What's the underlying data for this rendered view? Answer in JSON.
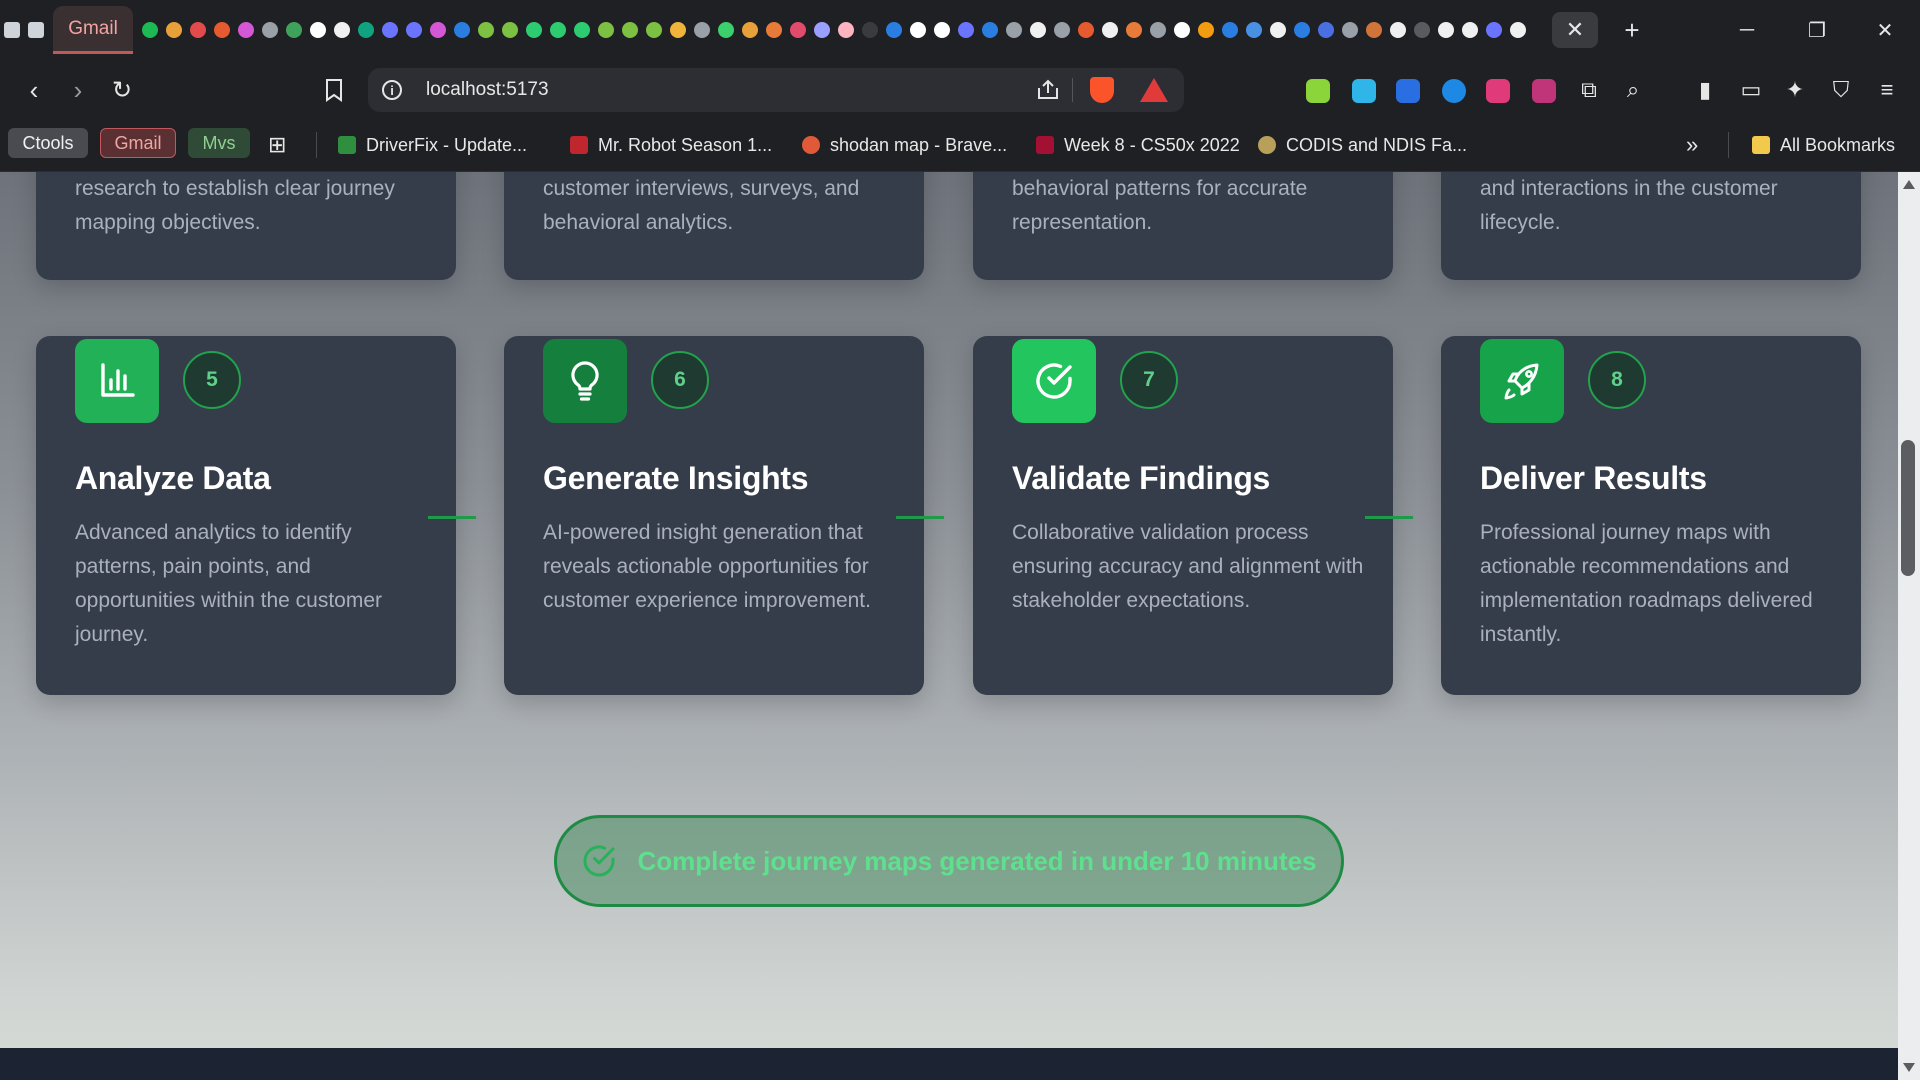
{
  "browser": {
    "active_tab_label": "Gmail",
    "url": "localhost:5173",
    "bookmarks": [
      {
        "label": "Ctools"
      },
      {
        "label": "Gmail"
      },
      {
        "label": "Mvs"
      },
      {
        "label": "DriverFix - Update..."
      },
      {
        "label": "Mr. Robot Season 1..."
      },
      {
        "label": "shodan map - Brave..."
      },
      {
        "label": "Week 8 - CS50x 2022"
      },
      {
        "label": "CODIS and NDIS Fa..."
      }
    ],
    "all_bookmarks": "All Bookmarks",
    "more_bookmarks": "»"
  },
  "steps_top": [
    {
      "desc": "research to establish clear journey mapping objectives."
    },
    {
      "desc": "customer interviews, surveys, and behavioral analytics."
    },
    {
      "desc": "behavioral patterns for accurate representation."
    },
    {
      "desc": "and interactions in the customer lifecycle."
    }
  ],
  "steps": [
    {
      "number": "5",
      "title": "Analyze Data",
      "icon": "bar-chart-icon",
      "desc": "Advanced analytics to identify patterns, pain points, and opportunities within the customer journey."
    },
    {
      "number": "6",
      "title": "Generate Insights",
      "icon": "lightbulb-icon",
      "desc": "AI-powered insight generation that reveals actionable opportunities for customer experience improvement."
    },
    {
      "number": "7",
      "title": "Validate Findings",
      "icon": "check-circle-icon",
      "desc": "Collaborative validation process ensuring accuracy and alignment with stakeholder expectations."
    },
    {
      "number": "8",
      "title": "Deliver Results",
      "icon": "rocket-icon",
      "desc": "Professional journey maps with actionable recommendations and implementation roadmaps delivered instantly."
    }
  ],
  "banner": {
    "text": "Complete journey maps generated in under 10 minutes"
  },
  "colors": {
    "accent": "#22c55e",
    "card_bg": "#363d4a",
    "icon_green_dark": "#16a34a",
    "icon_green_light": "#22c55e"
  }
}
